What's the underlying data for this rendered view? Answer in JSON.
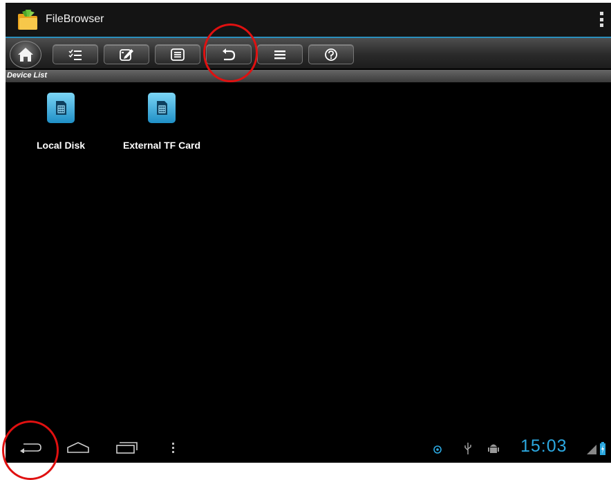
{
  "app": {
    "title": "FileBrowser",
    "app_icon": "folder-app-icon"
  },
  "toolbar": {
    "buttons": [
      {
        "name": "home",
        "icon": "home-icon"
      },
      {
        "name": "multi-select",
        "icon": "checklist-icon"
      },
      {
        "name": "edit",
        "icon": "edit-icon"
      },
      {
        "name": "list-view",
        "icon": "list-icon"
      },
      {
        "name": "back",
        "icon": "back-arrow-icon"
      },
      {
        "name": "menu",
        "icon": "menu-icon"
      },
      {
        "name": "help",
        "icon": "help-icon"
      }
    ]
  },
  "section": {
    "label": "Device List"
  },
  "devices": [
    {
      "label": "Local Disk",
      "icon": "sd-card-icon"
    },
    {
      "label": "External TF Card",
      "icon": "sd-card-icon"
    }
  ],
  "status": {
    "time": "15:03"
  },
  "colors": {
    "accent": "#2ca8e0",
    "highlight": "#e01010",
    "background": "#000000"
  }
}
